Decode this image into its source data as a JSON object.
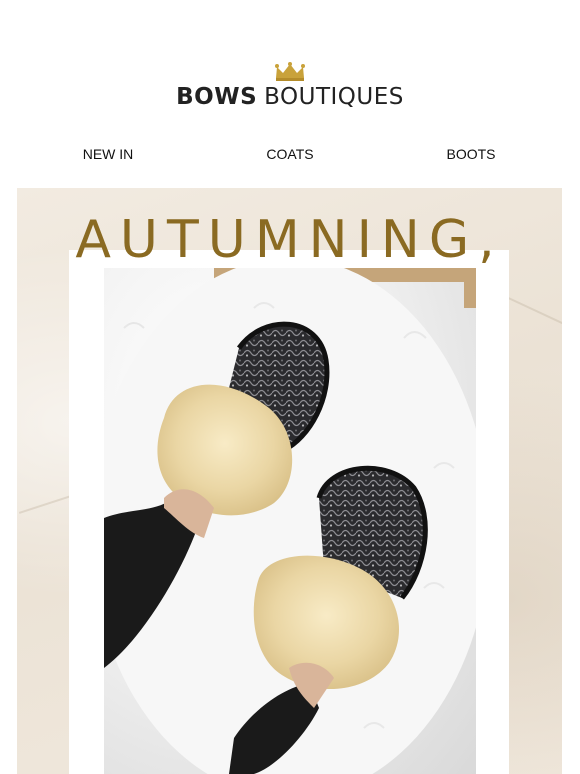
{
  "brand": {
    "bold": "BOWS",
    "light": "BOUTIQUES",
    "logo_icon": "crown-icon"
  },
  "nav": [
    {
      "label": "NEW IN"
    },
    {
      "label": "COATS"
    },
    {
      "label": "BOOTS"
    }
  ],
  "hero": {
    "headline": "AUTUMNING,",
    "image_alt_icon": "fur-slippers-photo"
  },
  "colors": {
    "headline": "#8a6a22",
    "crown": "#c9a23a",
    "background": "#efe7dc"
  }
}
